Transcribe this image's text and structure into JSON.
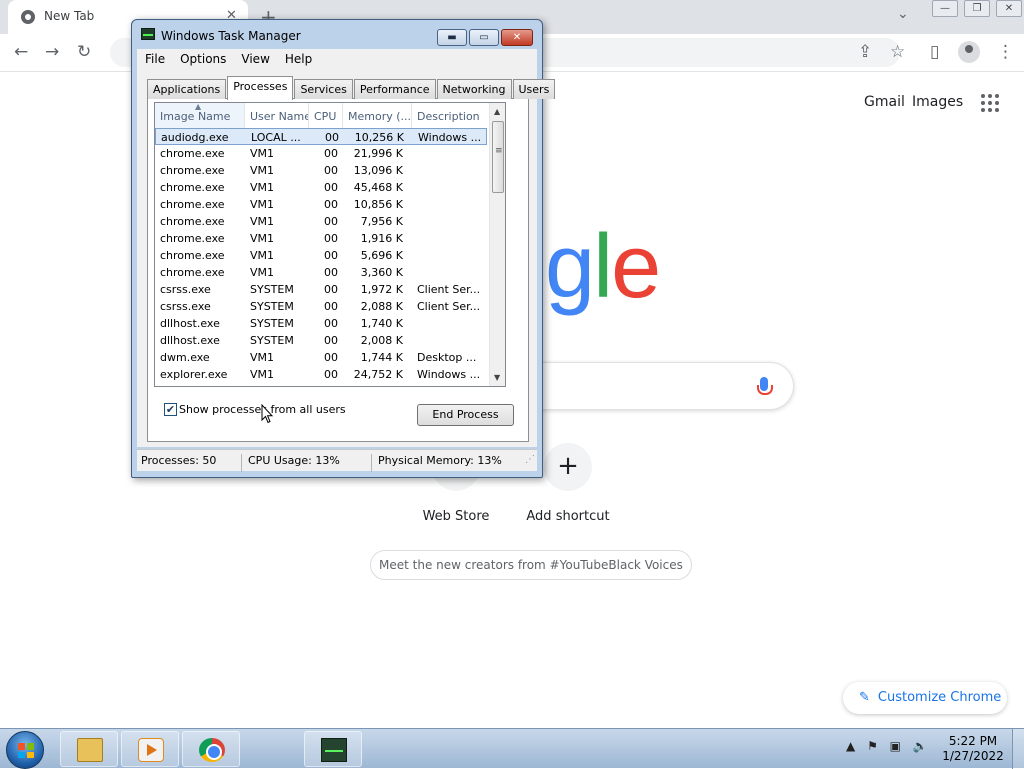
{
  "chrome": {
    "tab_title": "New Tab",
    "tab_close": "✕",
    "new_tab": "+",
    "tab_search": "⌄",
    "back": "←",
    "forward": "→",
    "reload": "↻",
    "share": "⇪",
    "bookmark": "☆",
    "side_panel": "▯",
    "menu": "⋮",
    "win_min": "—",
    "win_restore": "❐",
    "win_close": "✕"
  },
  "ntp": {
    "gmail": "Gmail",
    "images": "Images",
    "logo_visible": [
      "g",
      "l",
      "e"
    ],
    "logo_colors": {
      "g": "#4285f4",
      "l": "#34a853",
      "e": "#ea4335"
    },
    "shortcuts": [
      {
        "label": "Web Store",
        "glyph": ""
      },
      {
        "label": "Add shortcut",
        "glyph": "+"
      }
    ],
    "promo": "Meet the new creators from #YouTubeBlack Voices",
    "customize": "Customize Chrome",
    "customize_icon": "✎"
  },
  "task_manager": {
    "title": "Windows Task Manager",
    "controls": {
      "min": "▬",
      "max": "▭",
      "close": "✕"
    },
    "menu": [
      "File",
      "Options",
      "View",
      "Help"
    ],
    "tabs": [
      "Applications",
      "Processes",
      "Services",
      "Performance",
      "Networking",
      "Users"
    ],
    "active_tab": "Processes",
    "columns": [
      "Image Name",
      "User Name",
      "CPU",
      "Memory (...",
      "Description"
    ],
    "rows": [
      {
        "name": "audiodg.exe",
        "user": "LOCAL ...",
        "cpu": "00",
        "mem": "10,256 K",
        "desc": "Windows ..."
      },
      {
        "name": "chrome.exe",
        "user": "VM1",
        "cpu": "00",
        "mem": "21,996 K",
        "desc": ""
      },
      {
        "name": "chrome.exe",
        "user": "VM1",
        "cpu": "00",
        "mem": "13,096 K",
        "desc": ""
      },
      {
        "name": "chrome.exe",
        "user": "VM1",
        "cpu": "00",
        "mem": "45,468 K",
        "desc": ""
      },
      {
        "name": "chrome.exe",
        "user": "VM1",
        "cpu": "00",
        "mem": "10,856 K",
        "desc": ""
      },
      {
        "name": "chrome.exe",
        "user": "VM1",
        "cpu": "00",
        "mem": "7,956 K",
        "desc": ""
      },
      {
        "name": "chrome.exe",
        "user": "VM1",
        "cpu": "00",
        "mem": "1,916 K",
        "desc": ""
      },
      {
        "name": "chrome.exe",
        "user": "VM1",
        "cpu": "00",
        "mem": "5,696 K",
        "desc": ""
      },
      {
        "name": "chrome.exe",
        "user": "VM1",
        "cpu": "00",
        "mem": "3,360 K",
        "desc": ""
      },
      {
        "name": "csrss.exe",
        "user": "SYSTEM",
        "cpu": "00",
        "mem": "1,972 K",
        "desc": "Client Ser..."
      },
      {
        "name": "csrss.exe",
        "user": "SYSTEM",
        "cpu": "00",
        "mem": "2,088 K",
        "desc": "Client Ser..."
      },
      {
        "name": "dllhost.exe",
        "user": "SYSTEM",
        "cpu": "00",
        "mem": "1,740 K",
        "desc": ""
      },
      {
        "name": "dllhost.exe",
        "user": "SYSTEM",
        "cpu": "00",
        "mem": "2,008 K",
        "desc": ""
      },
      {
        "name": "dwm.exe",
        "user": "VM1",
        "cpu": "00",
        "mem": "1,744 K",
        "desc": "Desktop ..."
      },
      {
        "name": "explorer.exe",
        "user": "VM1",
        "cpu": "00",
        "mem": "24,752 K",
        "desc": "Windows ..."
      }
    ],
    "show_all_label": "Show processes from all users",
    "show_all_checked": true,
    "check_glyph": "✔",
    "end_process": "End Process",
    "status": {
      "processes": "Processes: 50",
      "cpu": "CPU Usage: 13%",
      "memory": "Physical Memory: 13%"
    }
  },
  "taskbar": {
    "tray": {
      "arrow": "▲",
      "flag": "⚑",
      "network": "▣",
      "volume": "🔈"
    },
    "time": "5:22 PM",
    "date": "1/27/2022"
  }
}
